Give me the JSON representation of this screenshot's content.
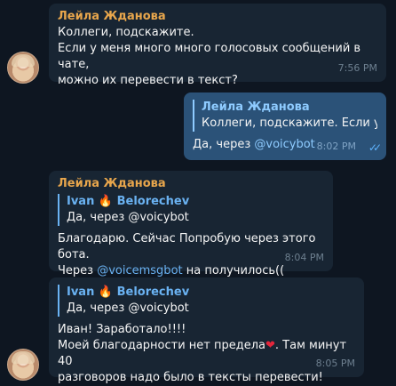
{
  "messages": {
    "m1": {
      "sender": "Лейла Жданова",
      "lines": [
        "Коллеги, подскажите.",
        "Если у меня много много голосовых сообщений в чате,",
        "можно их перевести в текст?"
      ],
      "time": "7:56 PM"
    },
    "m2": {
      "reply_name": "Лейла Жданова",
      "reply_text": "Коллеги, подскажите.  Если у ...",
      "text_prefix": "Да, через ",
      "link": "@voicybot",
      "time": "8:02 PM",
      "status_icon": "double-check-icon"
    },
    "m3": {
      "sender": "Лейла Жданова",
      "reply_name_a": "Ivan",
      "reply_name_b": "Belorechev",
      "reply_text": "Да, через @voicybot",
      "line1": "Благодарю. Сейчас Попробую через этого бота.",
      "line2_prefix": "Через ",
      "line2_link": "@voicemsgbot",
      "line2_suffix": " на получилось((",
      "time": "8:04 PM"
    },
    "m4": {
      "reply_name_a": "Ivan",
      "reply_name_b": "Belorechev",
      "reply_text": "Да, через @voicybot",
      "line1": "Иван! Заработало!!!!",
      "line2_prefix": "Моей благодарности нет предела",
      "line2_suffix": ". Там минут 40",
      "line3": "разговоров надо было в тексты перевести!",
      "time": "8:05 PM"
    }
  },
  "icons": {
    "fire": "🔥",
    "heart": "❤",
    "checks": "✓✓"
  },
  "colors": {
    "background": "#0e1621",
    "incoming_bubble": "#182533",
    "outgoing_bubble": "#2b5278",
    "sender_name": "#e8a64c",
    "link": "#6ab2f2"
  }
}
